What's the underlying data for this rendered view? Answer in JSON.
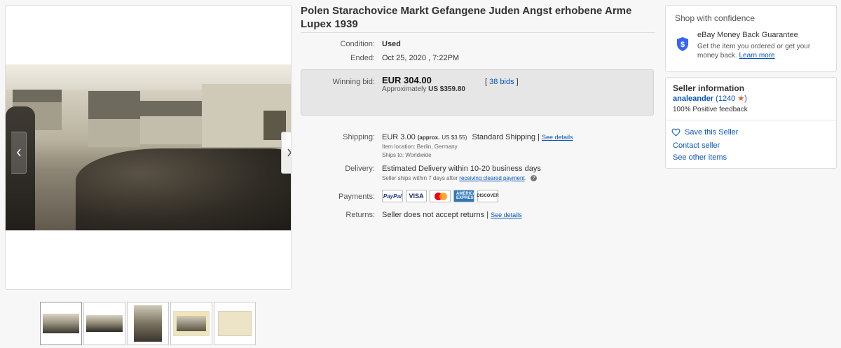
{
  "listing": {
    "title": "Polen Starachovice Markt Gefangene Juden Angst erhobene Arme Lupex 1939"
  },
  "details": {
    "condition_label": "Condition:",
    "condition_value": "Used",
    "ended_label": "Ended:",
    "ended_value": "Oct 25, 2020 , 7:22PM",
    "winning_bid_label": "Winning bid:",
    "winning_bid_value": "EUR 304.00",
    "approx_prefix": "Approximately",
    "approx_value": "US $359.80",
    "bids_open": "[",
    "bids_link": "38 bids",
    "bids_close": "]",
    "shipping_label": "Shipping:",
    "shipping_value": "EUR 3.00",
    "shipping_approx": "(approx.",
    "shipping_approx_value": "US $3.55)",
    "shipping_method": "Standard Shipping |",
    "shipping_see_details": "See details",
    "item_location": "Item location:  Berlin, Germany",
    "ships_to": "Ships to:  Worldwide",
    "delivery_label": "Delivery:",
    "delivery_value": "Estimated Delivery within 10-20 business days",
    "delivery_note_prefix": "Seller ships within 7 days after",
    "delivery_note_link": "receiving cleared payment",
    "delivery_note_suffix": ".",
    "payments_label": "Payments:",
    "returns_label": "Returns:",
    "returns_value": "Seller does not accept returns |",
    "returns_see_details": "See details"
  },
  "payment_methods": [
    "PayPal",
    "VISA",
    "mastercard",
    "AMERICAN EXPRESS",
    "DISCOVER"
  ],
  "confidence": {
    "title": "Shop with confidence",
    "guarantee_title": "eBay Money Back Guarantee",
    "guarantee_text": "Get the item you ordered or get your money back.",
    "learn_more": "Learn more"
  },
  "seller": {
    "heading": "Seller information",
    "name": "analeander",
    "score_open": "(",
    "score": "1240",
    "score_close": ")",
    "feedback": "100% Positive feedback",
    "save_seller": "Save this Seller",
    "contact": "Contact seller",
    "other_items": "See other items"
  },
  "icons": {
    "next": "chevron-right-icon",
    "prev": "chevron-left-icon",
    "shield": "shield-dollar-icon",
    "heart": "heart-icon",
    "star": "star-icon",
    "help": "help-icon"
  },
  "colors": {
    "link": "#0654ba",
    "star": "#e25d21",
    "shield": "#3665f3"
  }
}
